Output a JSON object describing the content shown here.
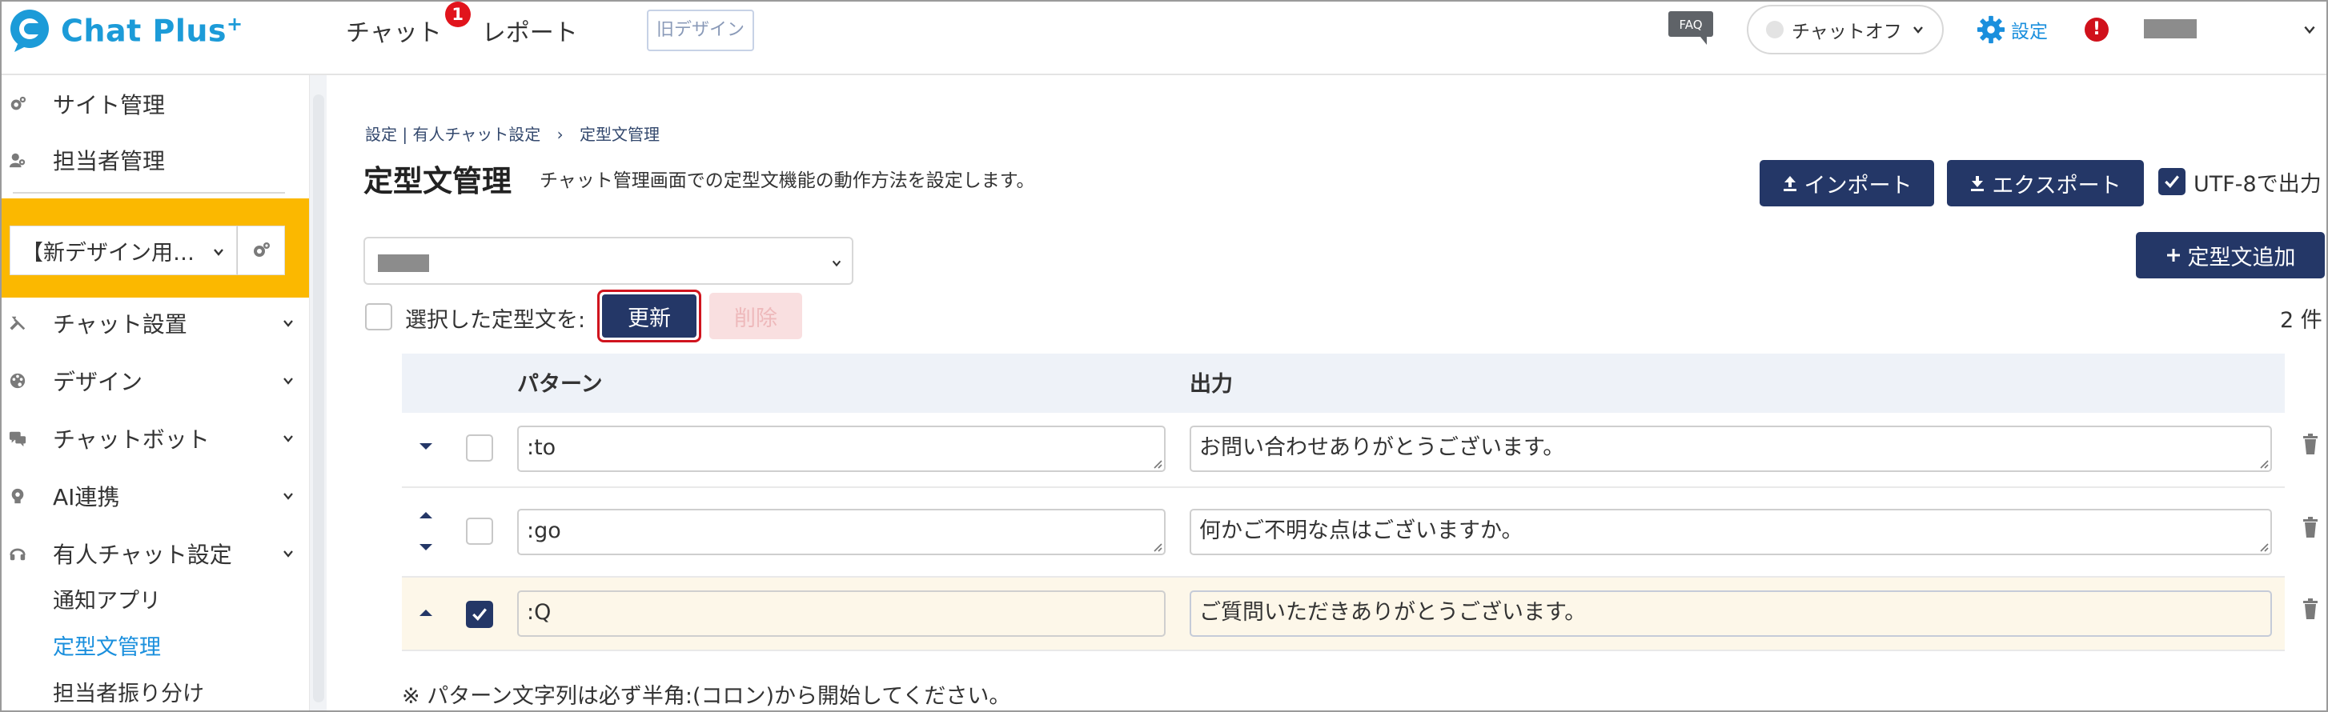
{
  "header": {
    "logo_text": "Chat Plus",
    "logo_sup": "+",
    "nav": [
      {
        "label": "チャット",
        "badge": "1"
      },
      {
        "label": "レポート"
      }
    ],
    "old_design_label": "旧デザイン",
    "faq_label": "FAQ",
    "chat_status_label": "チャットオフ",
    "settings_label": "設定",
    "alert_mark": "!"
  },
  "sidebar": {
    "top_items": [
      {
        "label": "サイト管理",
        "icon": "gear-icon"
      },
      {
        "label": "担当者管理",
        "icon": "users-icon"
      }
    ],
    "site_select_value": "【新デザイン用…",
    "menu": [
      {
        "label": "チャット設置",
        "icon": "tools-icon"
      },
      {
        "label": "デザイン",
        "icon": "palette-icon"
      },
      {
        "label": "チャットボット",
        "icon": "chat-bubble-icon"
      },
      {
        "label": "AI連携",
        "icon": "bulb-icon"
      },
      {
        "label": "有人チャット設定",
        "icon": "headset-icon"
      }
    ],
    "sub_items": [
      {
        "label": "通知アプリ",
        "active": false
      },
      {
        "label": "定型文管理",
        "active": true
      },
      {
        "label": "担当者振り分け",
        "active": false
      }
    ]
  },
  "main": {
    "breadcrumb": {
      "part1": "設定",
      "sep": "|",
      "part2": "有人チャット設定",
      "arrow": "›",
      "current": "定型文管理"
    },
    "title": "定型文管理",
    "description": "チャット管理画面での定型文機能の動作方法を設定します。",
    "import_label": "インポート",
    "export_label": "エクスポート",
    "utf8_label": "UTF-8で出力",
    "utf8_checked": true,
    "add_label": "定型文追加",
    "bulk_label": "選択した定型文を:",
    "update_label": "更新",
    "delete_label": "削除",
    "count_label": "2 件",
    "table": {
      "col_pattern": "パターン",
      "col_output": "出力",
      "rows": [
        {
          "pattern": ":to",
          "output": "お問い合わせありがとうございます。",
          "checked": false
        },
        {
          "pattern": ":go",
          "output": "何かご不明な点はございますか。",
          "checked": false
        },
        {
          "pattern": ":Q",
          "output": "ご質問いただきありがとうございます。",
          "checked": true
        }
      ]
    },
    "note": "※ パターン文字列は必ず半角:(コロン)から開始してください。"
  },
  "colors": {
    "navy": "#243767",
    "brand_blue": "#1c9bd8",
    "site_bg": "#fbb800",
    "alert_red": "#d0111b"
  }
}
